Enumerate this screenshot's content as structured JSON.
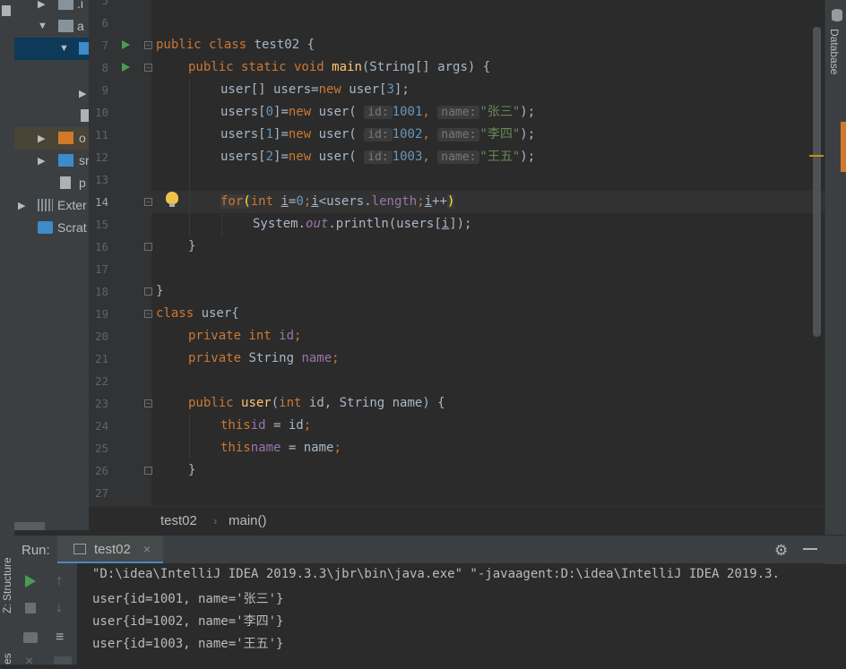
{
  "sidebar_left": {
    "structure_tab": "Z: Structure",
    "favorites_tab": "es"
  },
  "project_tree": {
    "items": [
      {
        "label": ".i",
        "icon": "folder-icon"
      },
      {
        "label": "a",
        "icon": "folder-icon"
      },
      {
        "label": "",
        "icon": "folder-icon"
      },
      {
        "label": "",
        "icon": "package-icon"
      },
      {
        "label": "",
        "icon": "file-icon"
      },
      {
        "label": "o",
        "icon": "folder-icon"
      },
      {
        "label": "sr",
        "icon": "folder-icon"
      },
      {
        "label": "p",
        "icon": "file-icon"
      },
      {
        "label": "Exter",
        "icon": "library-icon"
      },
      {
        "label": "Scrat",
        "icon": "scratches-icon"
      }
    ]
  },
  "editor": {
    "line_numbers": [
      "5",
      "6",
      "7",
      "8",
      "9",
      "10",
      "11",
      "12",
      "13",
      "14",
      "15",
      "16",
      "17",
      "18",
      "19",
      "20",
      "21",
      "22",
      "23",
      "24",
      "25",
      "26",
      "27"
    ],
    "current_line": "14",
    "code": {
      "l7": {
        "a": "public class ",
        "b": "test02 {"
      },
      "l8": {
        "a": "public static void ",
        "b": "main",
        "c": "(String[] args) {"
      },
      "l9": {
        "a": "user[] users=",
        "b": "new ",
        "c": "user[",
        "d": "3",
        "e": "];"
      },
      "l10": {
        "a": "users[",
        "b": "0",
        "c": "]=",
        "d": "new ",
        "e": "user(",
        "hint_id": "id:",
        "id": "1001",
        "comma": ",",
        "hint_name": "name:",
        "name": "\"张三\"",
        "end": ");"
      },
      "l11": {
        "a": "users[",
        "b": "1",
        "c": "]=",
        "d": "new ",
        "e": "user(",
        "hint_id": "id:",
        "id": "1002",
        "comma": ",",
        "hint_name": "name:",
        "name": "\"李四\"",
        "end": ");"
      },
      "l12": {
        "a": "users[",
        "b": "2",
        "c": "]=",
        "d": "new ",
        "e": "user(",
        "hint_id": "id:",
        "id": "1003",
        "comma": ",",
        "hint_name": "name:",
        "name": "\"王五\"",
        "end": ");"
      },
      "l14": {
        "a": "for",
        "b": "(",
        "c": "int ",
        "d": "i",
        "e": "=",
        "f": "0",
        ";": ";",
        "g": "i",
        "h": "<users.",
        "i": "length",
        ";2": ";",
        "j": "i",
        "k": "++",
        ")": ")"
      },
      "l15": {
        "a": "System.",
        "b": "out",
        "c": ".println(users[",
        "d": "i",
        "e": "]);"
      },
      "l16": "}",
      "l18": "}",
      "l19": {
        "a": "class ",
        "b": "user{"
      },
      "l20": {
        "a": "private int ",
        "b": "id",
        ";": ";"
      },
      "l21": {
        "a": "private ",
        "b": "String ",
        "c": "name",
        ";": ";"
      },
      "l23": {
        "a": "public ",
        "b": "user",
        "c": "(",
        "d": "int ",
        "e": "id, String name) {"
      },
      "l24": {
        "a": "this",
        ".": ".",
        "b": "id",
        "c": " = id",
        ";": ";"
      },
      "l25": {
        "a": "this",
        ".": ".",
        "b": "name",
        "c": " = name",
        ";": ";"
      },
      "l26": "}"
    }
  },
  "breadcrumb": {
    "items": [
      "test02",
      "main()"
    ],
    "separator": "›"
  },
  "right_sidebar": {
    "database_tab": "Database"
  },
  "run_panel": {
    "title": "Run:",
    "tab_label": "test02",
    "close": "×",
    "console_lines": [
      "\"D:\\idea\\IntelliJ IDEA 2019.3.3\\jbr\\bin\\java.exe\" \"-javaagent:D:\\idea\\IntelliJ IDEA 2019.3.",
      "user{id=1001, name='张三'}",
      "user{id=1002, name='李四'}",
      "user{id=1003, name='王五'}"
    ]
  },
  "colors": {
    "keyword": "#CC7832",
    "function": "#FFC66D",
    "number": "#6897BB",
    "string": "#6A8759",
    "field": "#9876AA",
    "run_green": "#499C54",
    "accent": "#4A88C7"
  }
}
